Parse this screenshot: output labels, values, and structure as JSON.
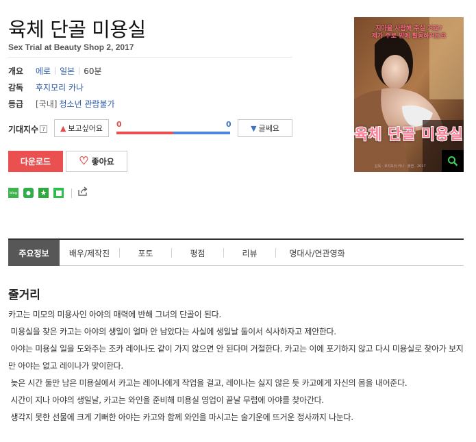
{
  "header": {
    "title": "육체 단골 미용실",
    "subtitle": "Sex Trial at Beauty Shop 2, 2017"
  },
  "info": {
    "overview_label": "개요",
    "genre": "에로",
    "country": "일본",
    "runtime": "60분",
    "director_label": "감독",
    "director": "후지모리 카나",
    "rating_label": "등급",
    "rating_region": "[국내]",
    "rating": "청소년 관람불가"
  },
  "expectation": {
    "label": "기대지수",
    "help_glyph": "?",
    "want_label": "보고싶어요",
    "meh_label": "글쎄요",
    "want_count": "0",
    "meh_count": "0",
    "want_ratio": 0.5,
    "colors": {
      "want": "#ea5050",
      "meh": "#4f86dd"
    }
  },
  "actions": {
    "download_label": "다운로드",
    "like_label": "좋아요"
  },
  "share": {
    "icons": [
      "blog-icon",
      "band-icon",
      "bookmark-star-icon",
      "line-icon",
      "share-icon"
    ],
    "blog_text": "blog"
  },
  "poster": {
    "top_text_line1": "지마을 사랑해 주실 거죠?",
    "top_text_line2": "제가 주로 밤에 활동하거든요",
    "title_text": "육체 단골 미용실",
    "credits_text": "감독 · 후지모리 카나 · 출연 · 2017"
  },
  "tabs": [
    {
      "label": "주요정보",
      "active": true
    },
    {
      "label": "배우/제작진",
      "active": false
    },
    {
      "label": "포토",
      "active": false
    },
    {
      "label": "평점",
      "active": false
    },
    {
      "label": "리뷰",
      "active": false
    },
    {
      "label": "명대사/연관영화",
      "active": false
    }
  ],
  "synopsis": {
    "heading": "줄거리",
    "lines": [
      "카고는 미모의 미용사인 아야의 매력에 반해 그녀의 단골이 된다.",
      " 미용실을 찾은 카고는 아야의 생일이 얼마 안 남았다는 사실에 생일날 둘이서 식사하자고 제안한다.",
      " 아야는 미용실 일을 도와주는 조카 레이나도 같이 가지 않으면 안 된다며 거절한다. 카고는 이에 포기하지 않고 다시 미용실로 찾아가 보지만 아야는 없고 레이나가 맞이한다.",
      " 늦은 시간 둘만 남은 미용실에서 카고는 레이나에게 작업을 걸고, 레이나는 싫지 않은 듯 카고에게 자신의 몸을 내어준다.",
      " 시간이 지나 아야의 생일날, 카고는 와인을 준비해 미용실 영업이 끝날 무렵에 아야를 찾아간다.",
      " 생각지 못한 선물에 크게 기뻐한 아야는 카고와 함께 와인을 마시고는 술기운에 뜨거운 정사까지 나눈다."
    ]
  }
}
